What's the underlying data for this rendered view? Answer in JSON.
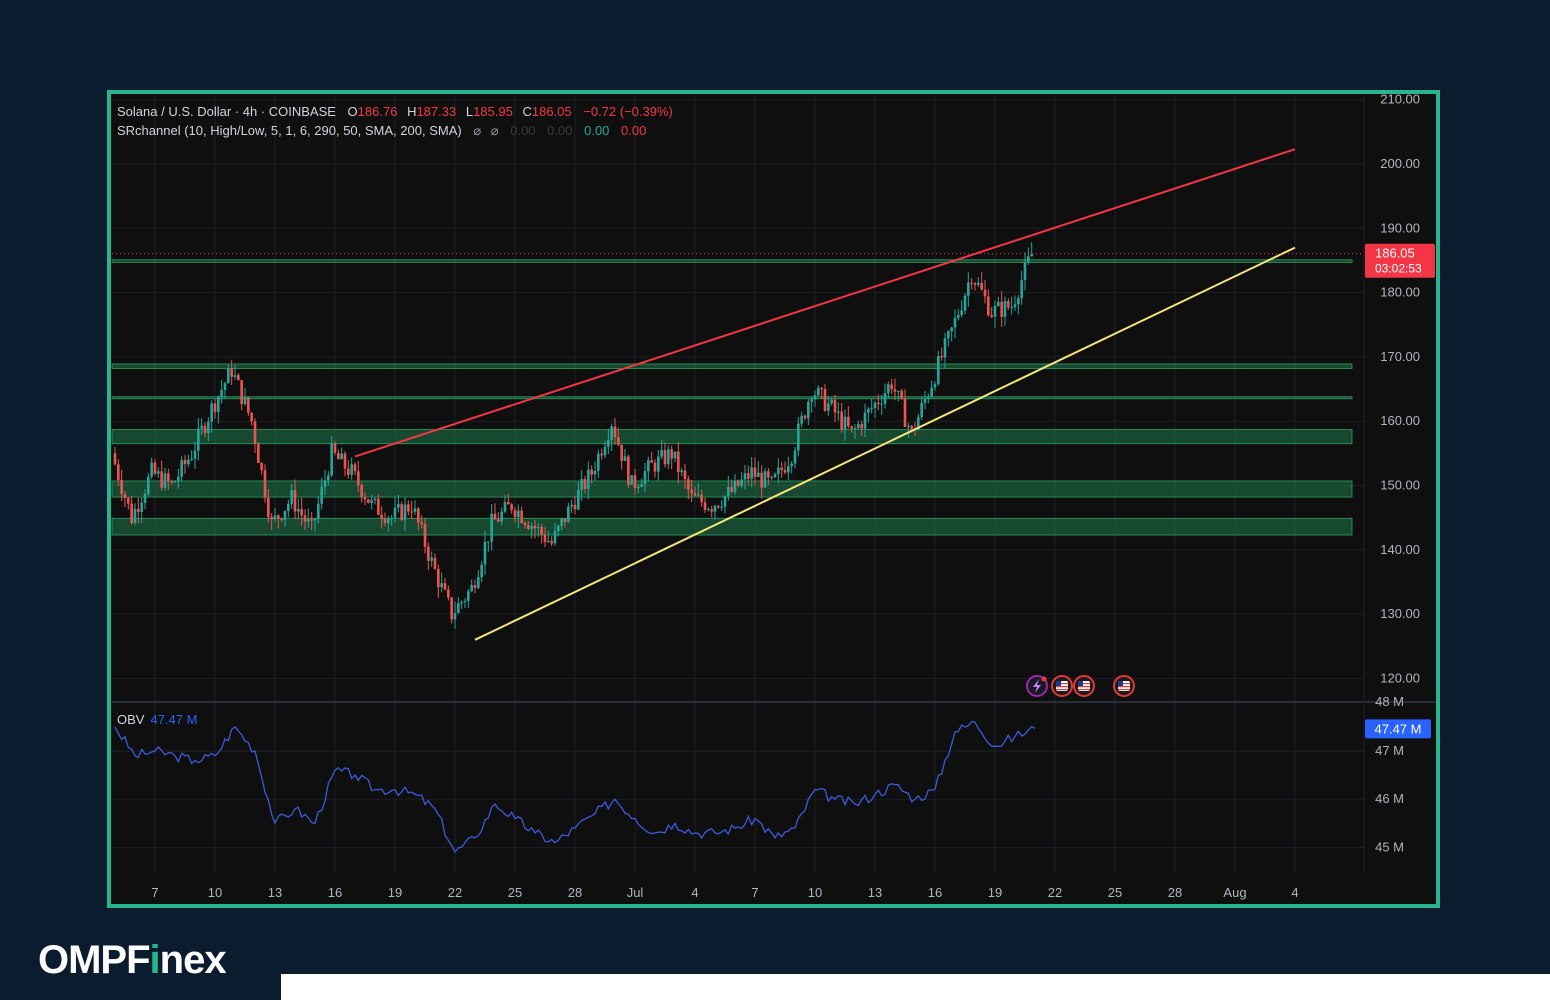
{
  "header": {
    "symbol": "Solana / U.S. Dollar · 4h · COINBASE",
    "o_label": "O",
    "o_value": "186.76",
    "h_label": "H",
    "h_value": "187.33",
    "l_label": "L",
    "l_value": "185.95",
    "c_label": "C",
    "c_value": "186.05",
    "change": "−0.72 (−0.39%)",
    "indicator": "SRchannel (10, High/Low, 5, 1, 6, 290, 50, SMA, 200, SMA)",
    "indicator_values": [
      "0.00",
      "0.00",
      "0.00",
      "0.00"
    ]
  },
  "price_badge": {
    "price": "186.05",
    "countdown": "03:02:53"
  },
  "obv": {
    "label": "OBV",
    "value": "47.47 M",
    "badge": "47.47 M"
  },
  "brand": {
    "name_part1": "OMPF",
    "name_i": "i",
    "name_part2": "nex"
  },
  "colors": {
    "up": "#26a69a",
    "down": "#ef5350",
    "resistance": "#f23645",
    "support": "#f5e77a",
    "zone": "#1f7a4a",
    "obv": "#3d5ad8",
    "frame": "#27b58c"
  },
  "chart_data": {
    "type": "candlestick",
    "title": "Solana / U.S. Dollar · 4h · COINBASE",
    "x_tick_labels": [
      "7",
      "10",
      "13",
      "16",
      "19",
      "22",
      "25",
      "28",
      "Jul",
      "4",
      "7",
      "10",
      "13",
      "16",
      "19",
      "22",
      "25",
      "28",
      "Aug",
      "4"
    ],
    "y_tick_labels": [
      "210.00",
      "200.00",
      "190.00",
      "180.00",
      "170.00",
      "160.00",
      "150.00",
      "140.00",
      "130.00",
      "120.00"
    ],
    "ylim": [
      118,
      211
    ],
    "last_price": 186.05,
    "price_path": [
      [
        "2024-06-05",
        155
      ],
      [
        "2024-06-06",
        145
      ],
      [
        "2024-06-07",
        152
      ],
      [
        "2024-06-08",
        150
      ],
      [
        "2024-06-09",
        155
      ],
      [
        "2024-06-10",
        162
      ],
      [
        "2024-06-11",
        168
      ],
      [
        "2024-06-12",
        160
      ],
      [
        "2024-06-13",
        144
      ],
      [
        "2024-06-14",
        148
      ],
      [
        "2024-06-15",
        143
      ],
      [
        "2024-06-16",
        155
      ],
      [
        "2024-06-17",
        152
      ],
      [
        "2024-06-18",
        147
      ],
      [
        "2024-06-19",
        145
      ],
      [
        "2024-06-20",
        147
      ],
      [
        "2024-06-21",
        138
      ],
      [
        "2024-06-22",
        130
      ],
      [
        "2024-06-23",
        134
      ],
      [
        "2024-06-24",
        144
      ],
      [
        "2024-06-25",
        147
      ],
      [
        "2024-06-26",
        144
      ],
      [
        "2024-06-27",
        141
      ],
      [
        "2024-06-28",
        147
      ],
      [
        "2024-06-29",
        152
      ],
      [
        "2024-06-30",
        160
      ],
      [
        "2024-07-01",
        150
      ],
      [
        "2024-07-02",
        153
      ],
      [
        "2024-07-03",
        155
      ],
      [
        "2024-07-04",
        148
      ],
      [
        "2024-07-05",
        147
      ],
      [
        "2024-07-06",
        149
      ],
      [
        "2024-07-07",
        152
      ],
      [
        "2024-07-08",
        150
      ],
      [
        "2024-07-09",
        155
      ],
      [
        "2024-07-10",
        165
      ],
      [
        "2024-07-11",
        162
      ],
      [
        "2024-07-12",
        158
      ],
      [
        "2024-07-13",
        162
      ],
      [
        "2024-07-14",
        166
      ],
      [
        "2024-07-15",
        158
      ],
      [
        "2024-07-16",
        166
      ],
      [
        "2024-07-17",
        174
      ],
      [
        "2024-07-18",
        183
      ],
      [
        "2024-07-19",
        177
      ],
      [
        "2024-07-20",
        178
      ],
      [
        "2024-07-21",
        186
      ]
    ],
    "sr_zones": [
      [
        168.2,
        168.9
      ],
      [
        163.5,
        163.8
      ],
      [
        156.5,
        158.7
      ],
      [
        148.2,
        150.7
      ],
      [
        142.3,
        144.9
      ],
      [
        184.7,
        185.1
      ]
    ],
    "resistance_line": [
      [
        "2024-06-17",
        154.5
      ],
      [
        "2024-08-03",
        202.3
      ]
    ],
    "support_line": [
      [
        "2024-06-23",
        126.0
      ],
      [
        "2024-08-03",
        187.0
      ]
    ],
    "obv": {
      "ylim": [
        44.6,
        48.1
      ],
      "y_tick_labels": [
        "48 M",
        "47 M",
        "46 M",
        "45 M"
      ],
      "path": [
        [
          "2024-06-05",
          47.5
        ],
        [
          "2024-06-06",
          46.9
        ],
        [
          "2024-06-07",
          47.0
        ],
        [
          "2024-06-08",
          46.9
        ],
        [
          "2024-06-09",
          46.8
        ],
        [
          "2024-06-10",
          46.9
        ],
        [
          "2024-06-11",
          47.5
        ],
        [
          "2024-06-12",
          47.0
        ],
        [
          "2024-06-13",
          45.5
        ],
        [
          "2024-06-14",
          45.8
        ],
        [
          "2024-06-15",
          45.5
        ],
        [
          "2024-06-16",
          46.6
        ],
        [
          "2024-06-17",
          46.5
        ],
        [
          "2024-06-18",
          46.2
        ],
        [
          "2024-06-19",
          46.2
        ],
        [
          "2024-06-20",
          46.1
        ],
        [
          "2024-06-21",
          45.8
        ],
        [
          "2024-06-22",
          44.9
        ],
        [
          "2024-06-23",
          45.2
        ],
        [
          "2024-06-24",
          45.9
        ],
        [
          "2024-06-25",
          45.6
        ],
        [
          "2024-06-26",
          45.3
        ],
        [
          "2024-06-27",
          45.1
        ],
        [
          "2024-06-28",
          45.4
        ],
        [
          "2024-06-29",
          45.7
        ],
        [
          "2024-06-30",
          46.0
        ],
        [
          "2024-07-01",
          45.6
        ],
        [
          "2024-07-02",
          45.3
        ],
        [
          "2024-07-03",
          45.5
        ],
        [
          "2024-07-04",
          45.3
        ],
        [
          "2024-07-05",
          45.3
        ],
        [
          "2024-07-06",
          45.4
        ],
        [
          "2024-07-07",
          45.6
        ],
        [
          "2024-07-08",
          45.2
        ],
        [
          "2024-07-09",
          45.4
        ],
        [
          "2024-07-10",
          46.2
        ],
        [
          "2024-07-11",
          46.0
        ],
        [
          "2024-07-12",
          45.9
        ],
        [
          "2024-07-13",
          46.1
        ],
        [
          "2024-07-14",
          46.3
        ],
        [
          "2024-07-15",
          46.0
        ],
        [
          "2024-07-16",
          46.2
        ],
        [
          "2024-07-17",
          47.4
        ],
        [
          "2024-07-18",
          47.6
        ],
        [
          "2024-07-19",
          47.1
        ],
        [
          "2024-07-20",
          47.3
        ],
        [
          "2024-07-21",
          47.47
        ]
      ]
    }
  }
}
